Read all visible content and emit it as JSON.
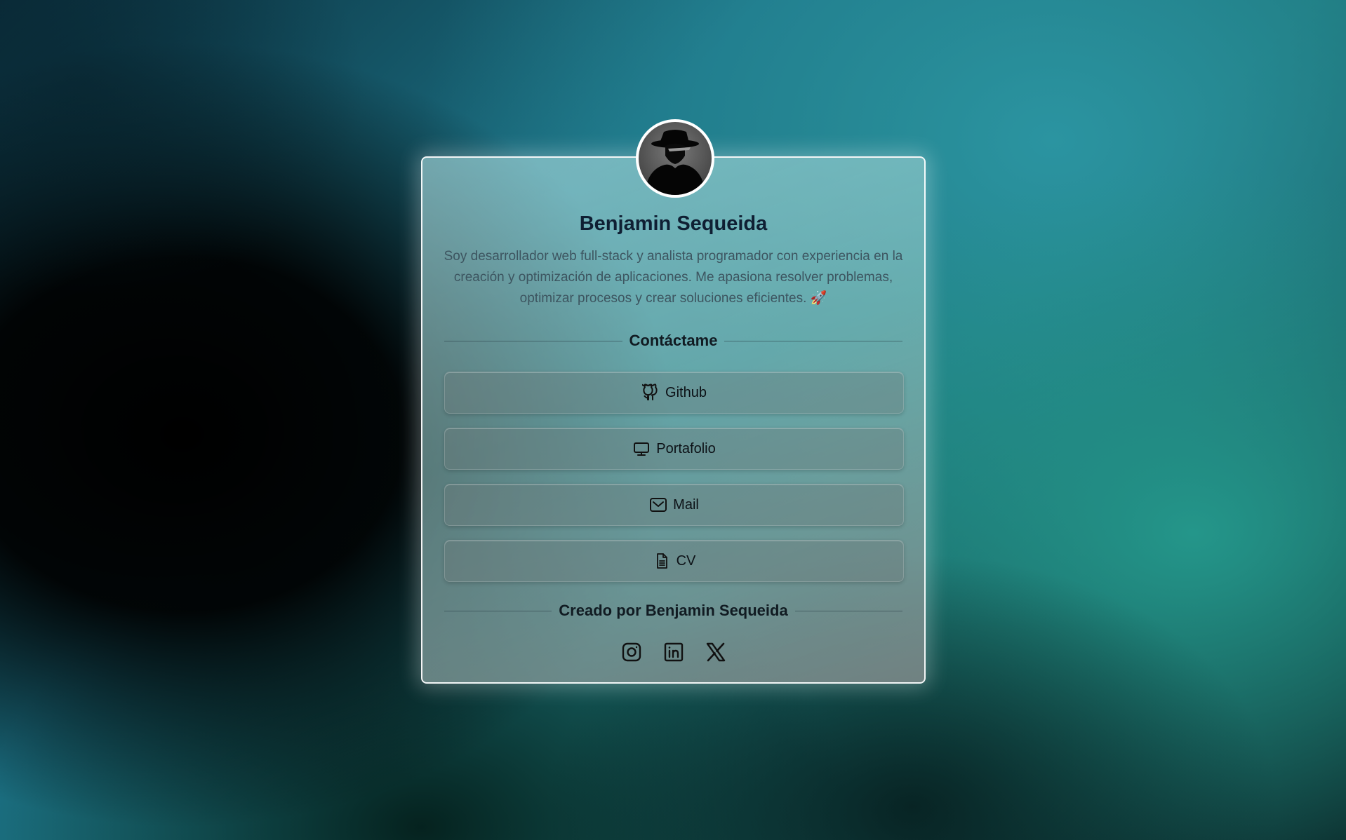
{
  "profile": {
    "name": "Benjamin Sequeida",
    "bio": "Soy desarrollador web full-stack y analista programador con experiencia en la creación y optimización de aplicaciones. Me apasiona resolver problemas, optimizar procesos y crear soluciones eficientes.",
    "bio_emoji": "🚀",
    "avatar_icon": "detective-silhouette-icon"
  },
  "contact": {
    "heading": "Contáctame",
    "links": [
      {
        "label": "Github",
        "icon": "github-icon"
      },
      {
        "label": "Portafolio",
        "icon": "monitor-icon"
      },
      {
        "label": "Mail",
        "icon": "mail-icon"
      },
      {
        "label": "CV",
        "icon": "document-icon"
      }
    ]
  },
  "footer": {
    "credit": "Creado por Benjamin Sequeida",
    "socials": [
      {
        "icon": "instagram-icon"
      },
      {
        "icon": "linkedin-icon"
      },
      {
        "icon": "x-twitter-icon"
      }
    ]
  },
  "colors": {
    "card_border": "#ffffff",
    "name_text": "#0f1f33",
    "bio_text": "#3d5560"
  }
}
